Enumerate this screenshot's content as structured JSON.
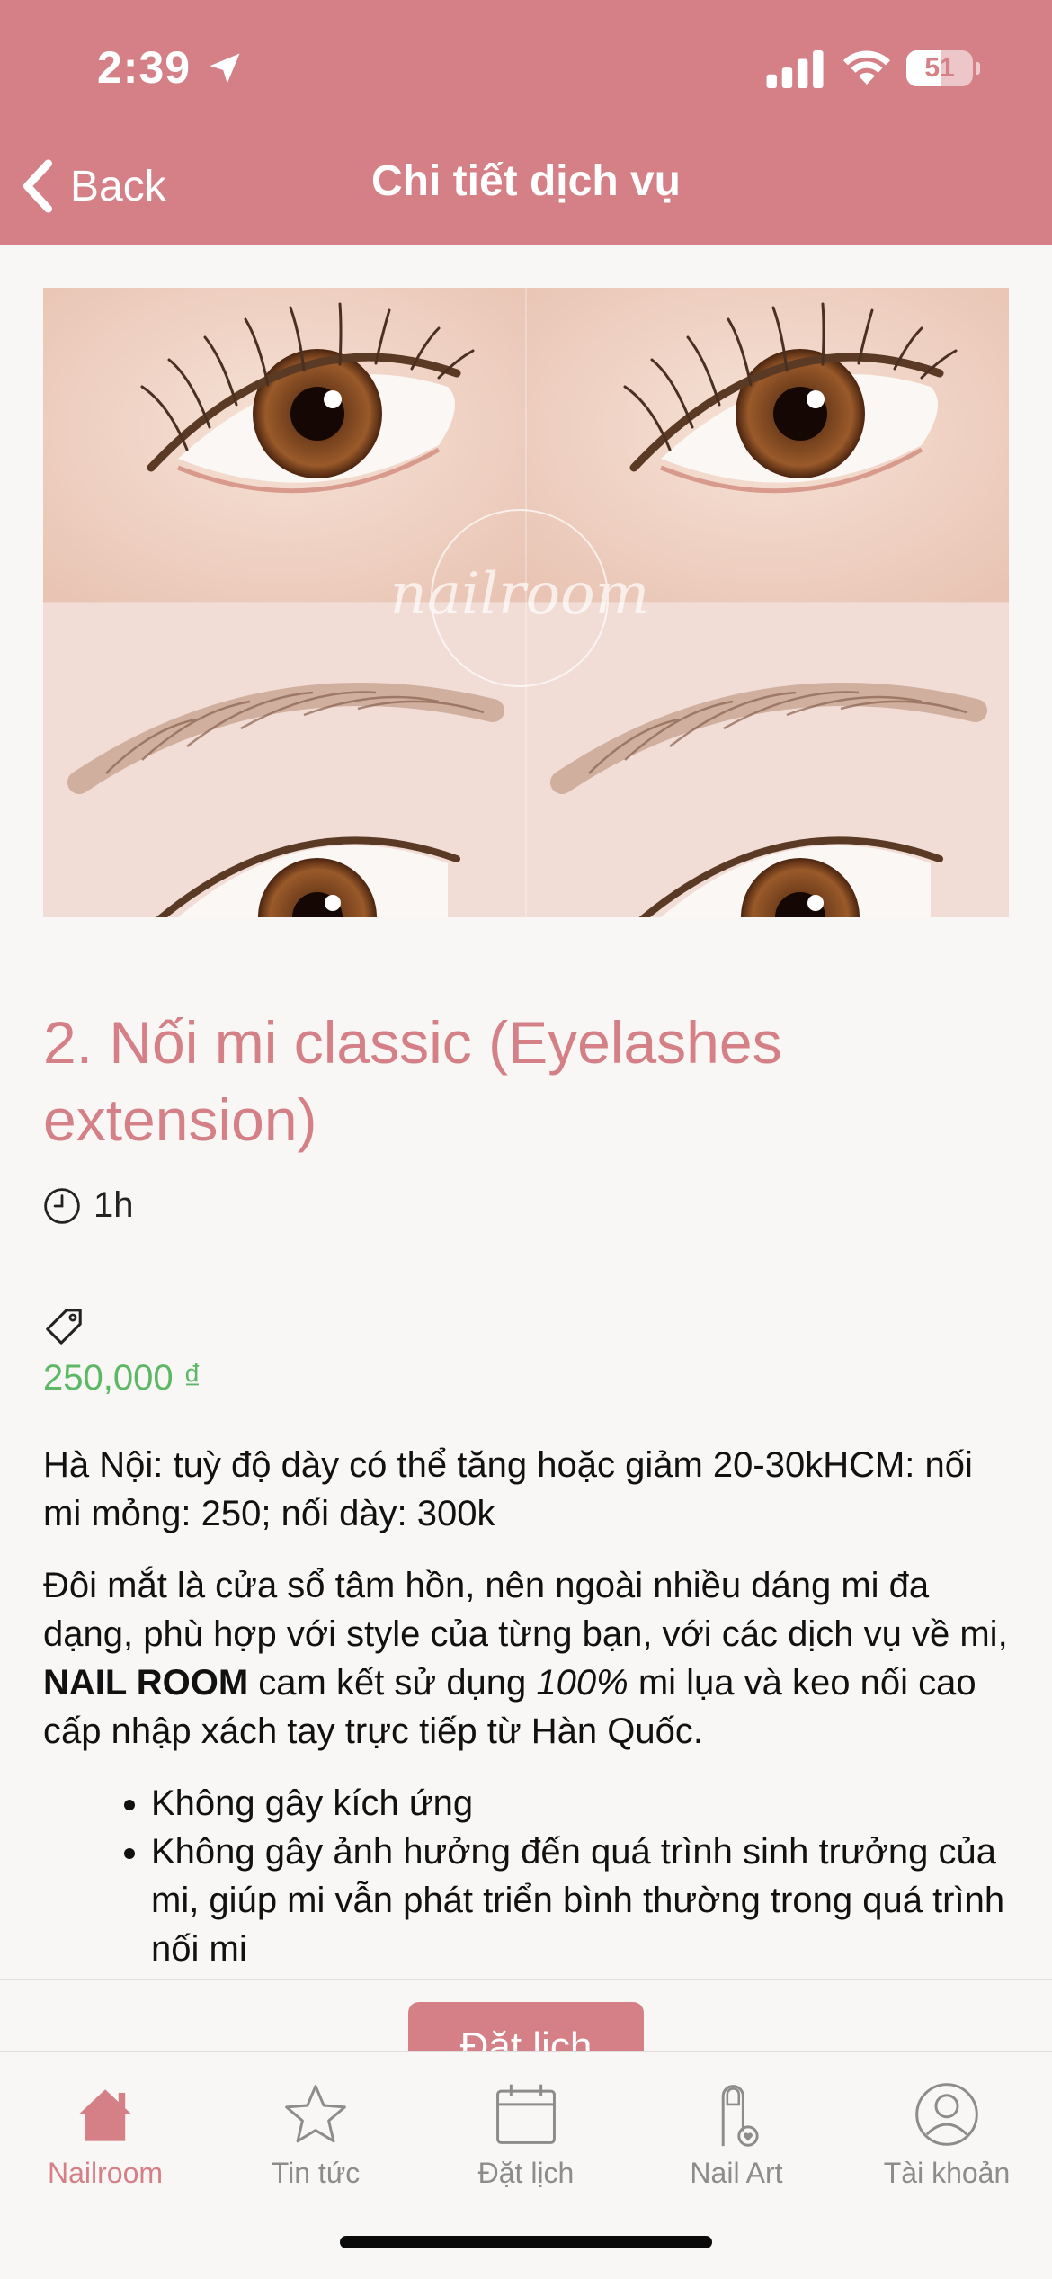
{
  "status_bar": {
    "time": "2:39",
    "battery_level": "51",
    "battery_fraction": 0.51
  },
  "nav": {
    "back_label": "Back",
    "title": "Chi tiết dịch vụ"
  },
  "service": {
    "title": "2. Nối mi classic (Eyelashes extension)",
    "duration": "1h",
    "price": "250,000 ₫",
    "note_line": "Hà Nội: tuỳ độ dày có thể tăng hoặc giảm 20-30kHCM: nối mi mỏng: 250; nối dày: 300k",
    "para_part1": "Đôi mắt là cửa sổ tâm hồn, nên ngoài nhiều dáng mi đa dạng, phù hợp với style của từng bạn, với các dịch vụ về mi, ",
    "para_brand": "NAIL ROOM",
    "para_part2": " cam kết sử dụng ",
    "para_percent": "100%",
    "para_part3": " mi lụa và keo nối cao cấp nhập xách tay trực tiếp từ Hàn Quốc.",
    "bullets": [
      "Không gây kích ứng",
      "Không gây ảnh hưởng đến quá trình sinh trưởng của mi, giúp mi vẫn phát triển bình thường trong quá trình nối mi"
    ],
    "image_watermark": "nailroom"
  },
  "book_button_label": "Đặt lịch",
  "tabs": [
    {
      "label": "Nailroom",
      "icon": "home-icon",
      "active": true
    },
    {
      "label": "Tin tức",
      "icon": "star-icon",
      "active": false
    },
    {
      "label": "Đặt lịch",
      "icon": "calendar-icon",
      "active": false
    },
    {
      "label": "Nail Art",
      "icon": "nail-icon",
      "active": false
    },
    {
      "label": "Tài khoản",
      "icon": "user-icon",
      "active": false
    }
  ],
  "colors": {
    "brand": "#d48086",
    "price": "#5cb865",
    "tab_inactive": "#8c8c8c",
    "background": "#f8f7f5"
  }
}
